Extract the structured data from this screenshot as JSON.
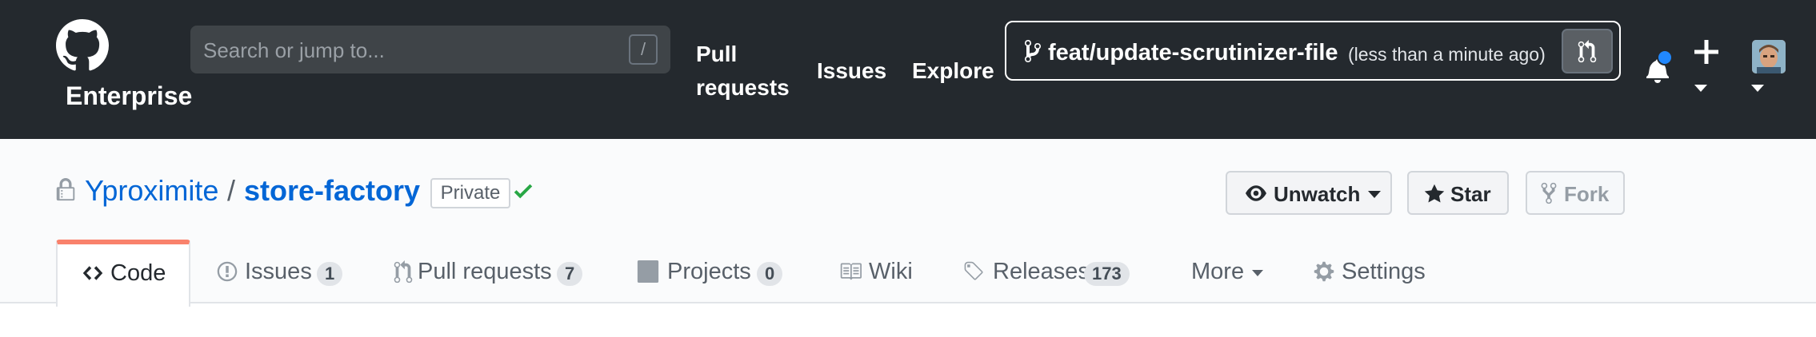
{
  "header": {
    "logo_text": "Enterprise",
    "search_placeholder": "Search or jump to...",
    "search_shortcut": "/",
    "nav": [
      "Pull requests",
      "Issues",
      "Explore"
    ],
    "recent_branch": {
      "name": "feat/update-scrutinizer-file",
      "time": "(less than a minute ago)"
    },
    "notification_unread": true,
    "icons": [
      "github-mark-icon",
      "git-branch-icon",
      "pull-request-icon",
      "bell-icon",
      "plus-icon",
      "avatar"
    ]
  },
  "repo": {
    "owner": "Yproximite",
    "separator": "/",
    "name": "store-factory",
    "visibility": "Private",
    "status": "success",
    "actions": {
      "unwatch": "Unwatch",
      "star": "Star",
      "fork": "Fork"
    }
  },
  "tabs": [
    {
      "label": "Code",
      "icon": "code-icon",
      "selected": true
    },
    {
      "label": "Issues",
      "count": "1",
      "icon": "issue-icon"
    },
    {
      "label": "Pull requests",
      "count": "7",
      "icon": "pull-request-icon"
    },
    {
      "label": "Projects",
      "count": "0",
      "icon": "project-icon"
    },
    {
      "label": "Wiki",
      "icon": "book-icon"
    },
    {
      "label": "Releases",
      "count": "173",
      "icon": "tag-icon"
    },
    {
      "label": "More",
      "icon": "caret-down-icon"
    },
    {
      "label": "Settings",
      "icon": "gear-icon"
    }
  ],
  "colors": {
    "header_bg": "#24292e",
    "link": "#0366d6",
    "success": "#28a745",
    "selected_tab_accent": "#f9826c",
    "notification_dot": "#2188ff"
  }
}
